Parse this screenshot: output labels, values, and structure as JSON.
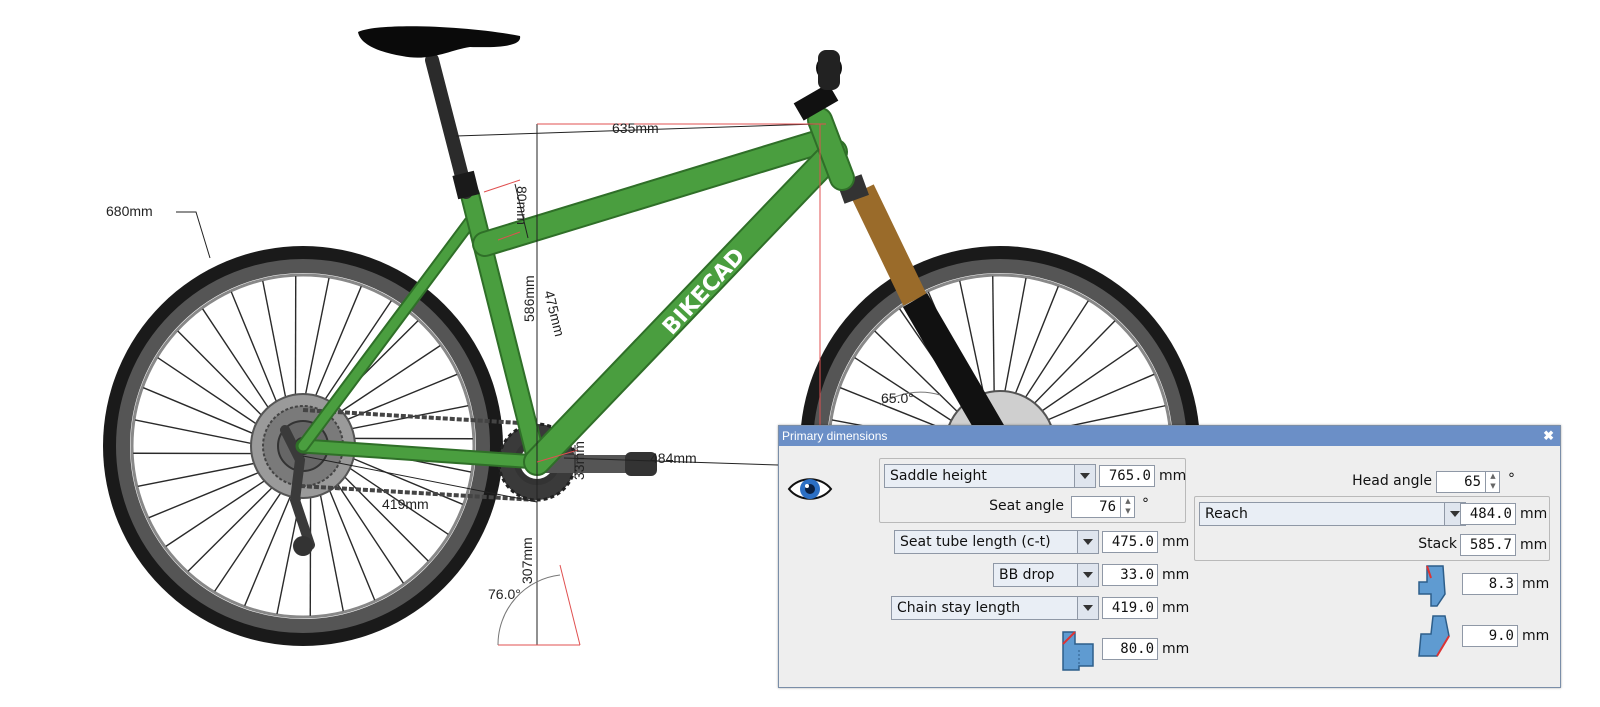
{
  "drawing": {
    "wheel_diameter": "680mm",
    "top_length": "635mm",
    "seat_cluster": "80mm",
    "seat_tube_ct_dim": "475mm",
    "vertical_dim": "586mm",
    "reach_dim": "484mm",
    "bb_drop_dim": "33mm",
    "chainstay_dim": "419mm",
    "bb_height_dim": "307mm",
    "seat_angle_dim": "76.0°",
    "head_angle_dim": "65.0°",
    "brand": "BIKECAD",
    "frame_color": "#4a9e3f",
    "fork_color": "#9a6b2a"
  },
  "dialog": {
    "title": "Primary dimensions",
    "close_label": "✖",
    "saddle_height": {
      "label": "Saddle height",
      "value": "765.0",
      "unit": "mm"
    },
    "seat_angle": {
      "label": "Seat angle",
      "value": "76",
      "unit": "°"
    },
    "seat_tube_length": {
      "label": "Seat tube length (c-t)",
      "value": "475.0",
      "unit": "mm"
    },
    "bb_drop": {
      "label": "BB drop",
      "value": "33.0",
      "unit": "mm"
    },
    "chain_stay_length": {
      "label": "Chain stay length",
      "value": "419.0",
      "unit": "mm"
    },
    "seat_cluster_offset": {
      "value": "80.0",
      "unit": "mm"
    },
    "head_angle": {
      "label": "Head angle",
      "value": "65",
      "unit": "°"
    },
    "reach": {
      "label": "Reach",
      "value": "484.0",
      "unit": "mm"
    },
    "stack": {
      "label": "Stack",
      "value": "585.7",
      "unit": "mm"
    },
    "head_offset_top": {
      "value": "8.3",
      "unit": "mm"
    },
    "head_offset_bottom": {
      "value": "9.0",
      "unit": "mm"
    }
  }
}
